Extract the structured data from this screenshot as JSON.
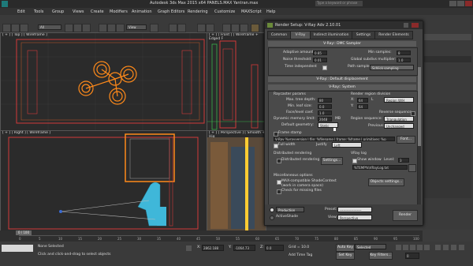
{
  "window": {
    "title": "Autodesk 3ds Max 2015 x64    PANELS.MAX    Yantran.max",
    "search_placeholder": "Type a keyword or phrase"
  },
  "menu": [
    "Edit",
    "Tools",
    "Group",
    "Views",
    "Create",
    "Modifiers",
    "Animation",
    "Graph Editors",
    "Rendering",
    "Customize",
    "MAXScript",
    "Help"
  ],
  "toolbar": {
    "selection_filter": "All",
    "view_dropdown": "View"
  },
  "viewports": {
    "top": "[ + ] [ Top ] [ Wireframe ]",
    "front": "[ + ] [ Front ] [ Wireframe + Edged F",
    "right": "[ + ] [ Right ] [ Wireframe ]",
    "perspective": "[ + ] [ Perspective ] [ Smooth + Hig"
  },
  "dialog": {
    "title": "Render Setup: V-Ray Adv 2.10.01",
    "tabs": [
      "Common",
      "V-Ray",
      "Indirect illumination",
      "Settings",
      "Render Elements"
    ],
    "dmc": {
      "header": "V-Ray:: DMC Sampler",
      "adaptive_amount_label": "Adaptive amount:",
      "adaptive_amount": "0.85",
      "noise_threshold_label": "Noise threshold:",
      "noise_threshold": "0.01",
      "time_independent_label": "Time independent",
      "min_samples_label": "Min samples:",
      "min_samples": "8",
      "global_subdivs_label": "Global subdivs multiplier:",
      "global_subdivs": "1.0",
      "path_sampler_label": "Path sampler:",
      "path_sampler": "Schlick sampling"
    },
    "default_displacement_header": "V-Ray:: Default displacement",
    "system_header": "V-Ray:: System",
    "raycaster": {
      "title": "Raycaster params",
      "max_tree_depth_label": "Max. tree depth:",
      "max_tree_depth": "80",
      "min_leaf_size_label": "Min. leaf size:",
      "min_leaf_size": "0.0",
      "face_level_coef_label": "Face/level coef.",
      "face_level_coef": "1.0",
      "dynamic_memory_label": "Dynamic memory limit:",
      "dynamic_memory": "2048",
      "dynamic_memory_unit": "MB",
      "default_geometry_label": "Default geometry:",
      "default_geometry": "Static"
    },
    "region": {
      "title": "Render region division",
      "x_label": "X:",
      "x": "64",
      "y_label": "Y:",
      "y": "64",
      "l_label": "L",
      "mode": "Region W/H",
      "reverse_label": "Reverse sequence",
      "sequence_label": "Region sequence:",
      "sequence": "Triangulation",
      "previous_label": "Previous:",
      "previous": "Unchanged"
    },
    "frame_stamp": {
      "title": "Frame stamp",
      "text": "V-Ray %vrayversion | file: %filename | frame: %frame | primitives: %p",
      "font_button": "Font...",
      "full_width_label": "Full width",
      "justify_label": "Justify",
      "justify": "Left"
    },
    "distributed": {
      "title": "Distributed rendering",
      "checkbox_label": "Distributed rendering",
      "settings_button": "Settings..."
    },
    "vray_log": {
      "title": "VRay log",
      "show_window_label": "Show window",
      "level_label": "Level:",
      "level": "3",
      "path": "%TEMP%\\VRayLog.txt"
    },
    "misc": {
      "title": "Miscellaneous options",
      "shade_context_label": "MAX-compatible ShadeContext",
      "shade_context_sub": "(work in camera space)",
      "check_missing_label": "Check for missing files",
      "objects_settings_button": "Objects settings..."
    },
    "footer": {
      "production_label": "Production",
      "production": "Production",
      "activeshade_label": "ActiveShade",
      "preset_label": "Preset:",
      "preset": "-------------------",
      "view_label": "View:",
      "view": "Perspective",
      "render_button": "Render"
    }
  },
  "timeline": {
    "frame": "0 / 100",
    "ticks": [
      "0",
      "5",
      "10",
      "15",
      "20",
      "25",
      "30",
      "35",
      "40",
      "45",
      "50",
      "55",
      "60",
      "65",
      "70",
      "75",
      "80",
      "85",
      "90",
      "95",
      "100"
    ]
  },
  "status": {
    "selection": "None Selected",
    "prompt": "Click and click-and-drag to select objects",
    "x_label": "X:",
    "x": "2862.188",
    "y_label": "Y:",
    "y": "-1064.73",
    "z_label": "Z:",
    "z": "0.0",
    "grid_label": "Grid = 10.0",
    "add_time_tag": "Add Time Tag",
    "auto_key": "Auto Key",
    "set_key": "Set Key",
    "key_selection": "Selected",
    "key_filters": "Key Filters...",
    "frame_field": "0"
  },
  "colors": {
    "accent_orange": "#ff8a1a",
    "wire_red": "#d23a3a",
    "wire_green": "#3ab24a",
    "cyan_figure": "#3fb7d9"
  }
}
